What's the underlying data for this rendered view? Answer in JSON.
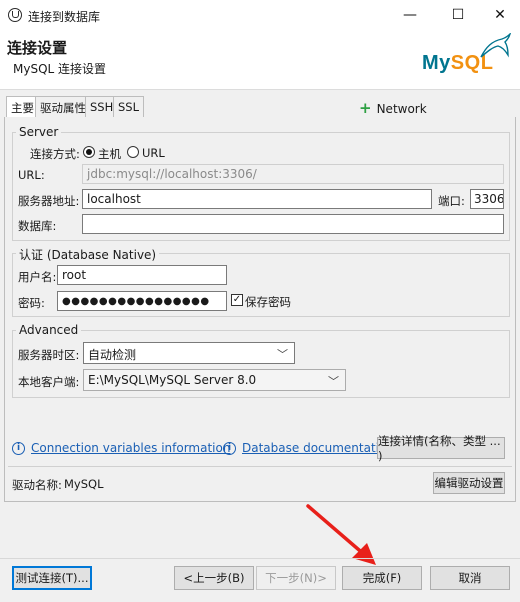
{
  "window": {
    "title": "连接到数据库",
    "minimize": "—",
    "maximize": "☐",
    "close": "✕"
  },
  "header": {
    "title": "连接设置",
    "subtitle": "MySQL 连接设置",
    "logo_my": "My",
    "logo_sql": "SQL"
  },
  "tabs": [
    "主要",
    "驱动属性",
    "SSH",
    "SSL"
  ],
  "network_configurations": "Network configurations...",
  "server": {
    "group_label": "Server",
    "connect_method_label": "连接方式:",
    "option_host": "主机",
    "option_url": "URL",
    "selected": "主机",
    "url_label": "URL:",
    "url_value": "jdbc:mysql://localhost:3306/",
    "host_label": "服务器地址:",
    "host_value": "localhost",
    "port_label": "端口:",
    "port_value": "3306",
    "database_label": "数据库:",
    "database_value": ""
  },
  "auth": {
    "group_label": "认证 (Database Native)",
    "username_label": "用户名:",
    "username_value": "root",
    "password_label": "密码:",
    "password_value": "●●●●●●●●●●●●●●●●",
    "save_password_label": "保存密码",
    "save_password_checked": true
  },
  "advanced": {
    "group_label": "Advanced",
    "timezone_label": "服务器时区:",
    "timezone_value": "自动检测",
    "local_client_label": "本地客户端:",
    "local_client_value": "E:\\MySQL\\MySQL Server 8.0"
  },
  "links": {
    "connection_variables": "Connection variables information",
    "database_documentation": "Database documentation",
    "connection_details_button": "连接详情(名称、类型 ... )"
  },
  "driver": {
    "label": "驱动名称:",
    "name": "MySQL",
    "edit_button": "编辑驱动设置"
  },
  "footer": {
    "test_button": "测试连接(T)...",
    "back_button": "<上一步(B)",
    "next_button": "下一步(N)>",
    "finish_button": "完成(F)",
    "cancel_button": "取消"
  },
  "colors": {
    "accent": "#0078d7",
    "link": "#1a5fb4",
    "mysql_blue": "#00758f",
    "mysql_orange": "#f29111",
    "arrow_red": "#e8201a"
  }
}
